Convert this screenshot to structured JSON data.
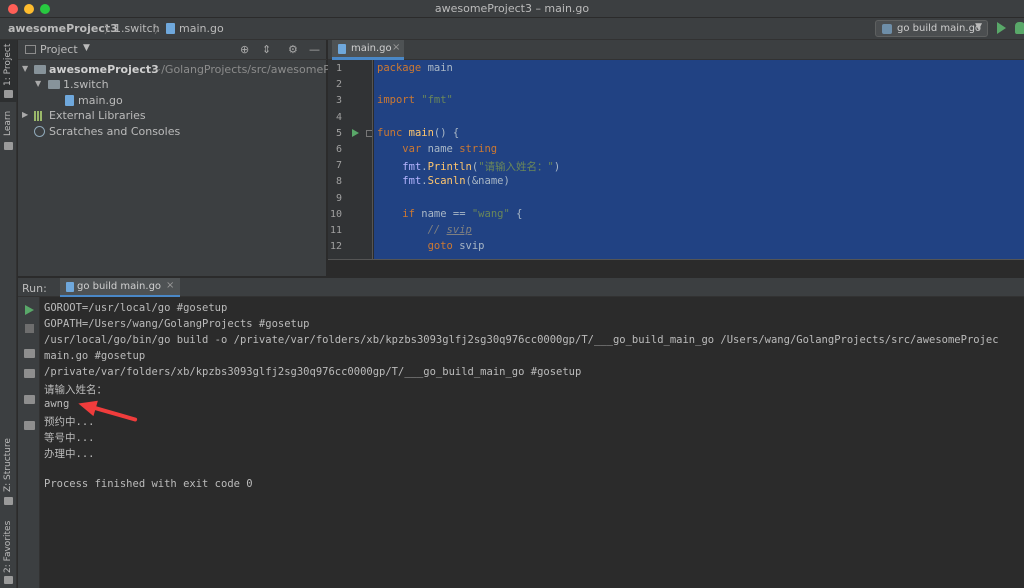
{
  "window": {
    "title": "awesomeProject3 – main.go"
  },
  "navbar": {
    "breadcrumbs": [
      "awesomeProject3",
      "1.switch",
      "main.go"
    ],
    "run_config": "go build main.go"
  },
  "left_stripe": {
    "tabs": [
      "1: Project",
      "Learn",
      "Z: Structure",
      "2: Favorites"
    ]
  },
  "project_panel": {
    "title": "Project",
    "tree": [
      {
        "label": "awesomeProject3",
        "path": "~/GolangProjects/src/awesomePr"
      },
      {
        "label": "1.switch"
      },
      {
        "label": "main.go"
      },
      {
        "label": "External Libraries"
      },
      {
        "label": "Scratches and Consoles"
      }
    ]
  },
  "editor": {
    "tab": "main.go",
    "line_numbers": [
      "1",
      "2",
      "3",
      "4",
      "5",
      "6",
      "7",
      "8",
      "9",
      "10",
      "11",
      "12"
    ],
    "code": {
      "l1_kw": "package",
      "l1_name": " main",
      "l3_kw": "import",
      "l3_str": "\"fmt\"",
      "l5_kw": "func",
      "l5_fn": "main",
      "l5_rest": "() {",
      "l6_kw": "var",
      "l6_name": " name ",
      "l6_type": "string",
      "l7_pkg": "fmt",
      "l7_fn": "Println",
      "l7_str": "\"请输入姓名：\"",
      "l8_pkg": "fmt",
      "l8_fn": "Scanln",
      "l8_rest": "(&name)",
      "l10_kw": "if",
      "l10_mid": " name == ",
      "l10_str": "\"wang\"",
      "l10_end": " {",
      "l11_prefix": "// ",
      "l11_word": "svip",
      "l12_kw": "goto",
      "l12_rest": " svip"
    }
  },
  "run_panel": {
    "label": "Run:",
    "tab": "go build main.go",
    "output": [
      "GOROOT=/usr/local/go #gosetup",
      "GOPATH=/Users/wang/GolangProjects #gosetup",
      "/usr/local/go/bin/go build -o /private/var/folders/xb/kpzbs3093glfj2sg30q976cc0000gp/T/___go_build_main_go /Users/wang/GolangProjects/src/awesomeProjec",
      "main.go #gosetup",
      "/private/var/folders/xb/kpzbs3093glfj2sg30q976cc0000gp/T/___go_build_main_go #gosetup",
      "请输入姓名：",
      "awng",
      "预约中...",
      "等号中...",
      "办理中...",
      "",
      "Process finished with exit code 0"
    ]
  },
  "colors": {
    "selection": "#214283",
    "keyword": "#cc7832",
    "string": "#6a8759",
    "annotation_arrow": "#f03c3c"
  }
}
